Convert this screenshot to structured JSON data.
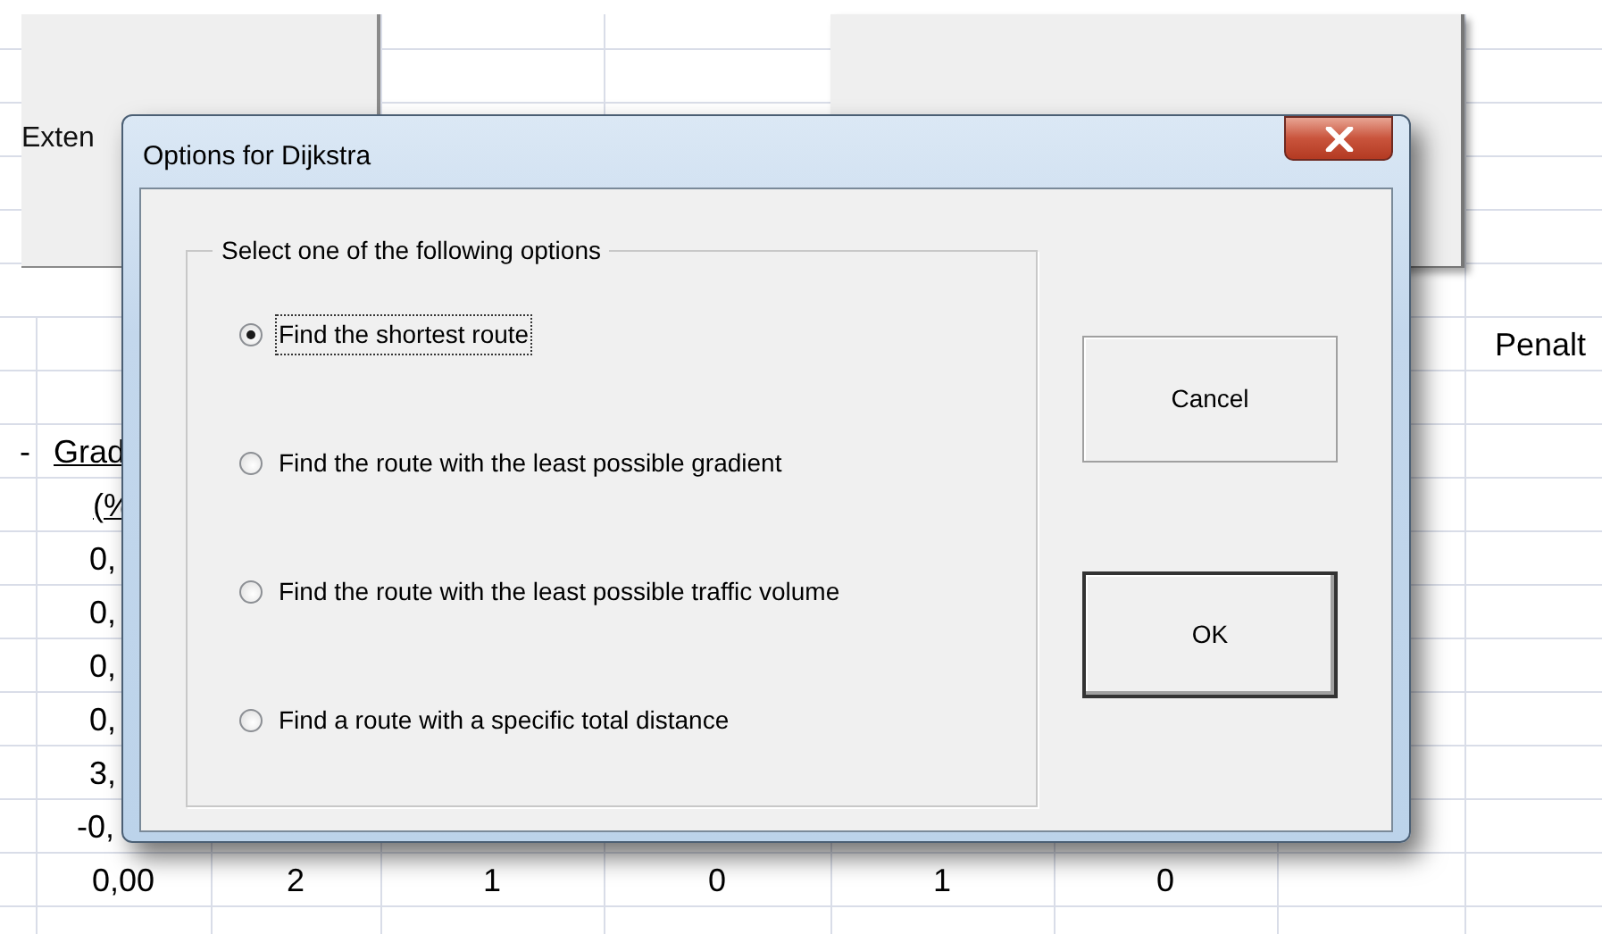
{
  "sheet": {
    "form_button": {
      "label": "Exten"
    },
    "rows": [
      {
        "column_8": "Penalt"
      },
      {
        "column_0": "-",
        "column_1": "Grad"
      },
      {
        "column_1": "(%"
      },
      {
        "column_1": "0,"
      },
      {
        "column_1": "0,"
      },
      {
        "column_1": "0,"
      },
      {
        "column_1": "0,"
      },
      {
        "column_1": "3,"
      },
      {
        "column_1": "-0,"
      },
      {
        "column_1": "0,00",
        "column_2": "2",
        "column_3": "1",
        "column_4": "0",
        "column_5": "1",
        "column_6": "0"
      }
    ]
  },
  "dialog": {
    "title": "Options for Dijkstra",
    "group": {
      "legend": "Select one of the following options",
      "options": [
        {
          "label": "Find the shortest route",
          "selected": true,
          "focused": true
        },
        {
          "label": "Find the route with the least possible gradient",
          "selected": false,
          "focused": false
        },
        {
          "label": "Find the route with the least possible traffic volume",
          "selected": false,
          "focused": false
        },
        {
          "label": "Find a route with a specific total distance",
          "selected": false,
          "focused": false
        }
      ]
    },
    "buttons": [
      {
        "label": "Cancel",
        "default": false
      },
      {
        "label": "OK",
        "default": true
      }
    ]
  }
}
